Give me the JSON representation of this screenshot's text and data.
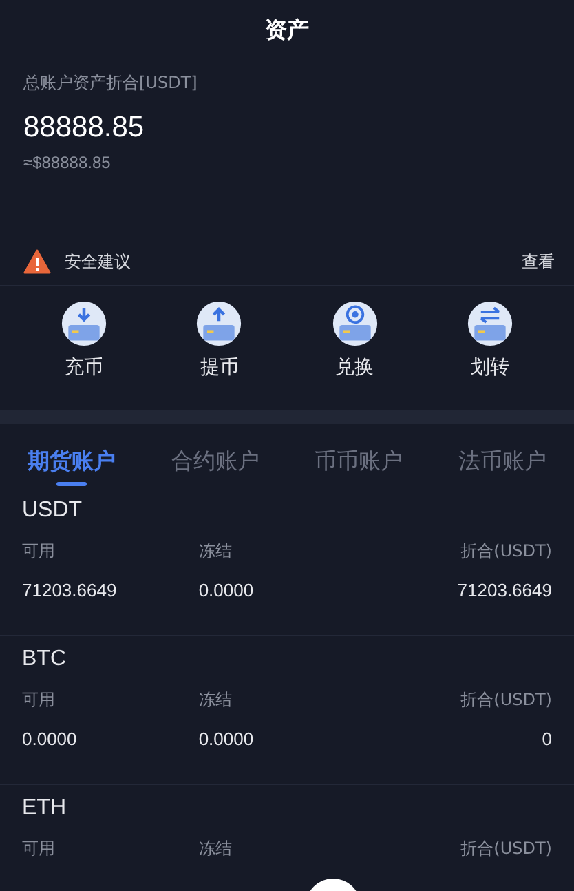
{
  "header": {
    "title": "资产"
  },
  "summary": {
    "label": "总账户资产折合[USDT]",
    "total": "88888.85",
    "approx": "≈$88888.85"
  },
  "security": {
    "label": "安全建议",
    "link": "查看"
  },
  "actions": [
    {
      "label": "充币",
      "kind": "deposit"
    },
    {
      "label": "提币",
      "kind": "withdraw"
    },
    {
      "label": "兑换",
      "kind": "exchange"
    },
    {
      "label": "划转",
      "kind": "transfer"
    }
  ],
  "tabs": [
    {
      "label": "期货账户",
      "selected": true
    },
    {
      "label": "合约账户",
      "selected": false
    },
    {
      "label": "币币账户",
      "selected": false
    },
    {
      "label": "法币账户",
      "selected": false
    }
  ],
  "assets": [
    {
      "name": "USDT",
      "columns": [
        "可用",
        "冻结",
        "折合(USDT)"
      ],
      "values": [
        "71203.6649",
        "0.0000",
        "71203.6649"
      ]
    },
    {
      "name": "BTC",
      "columns": [
        "可用",
        "冻结",
        "折合(USDT)"
      ],
      "values": [
        "0.0000",
        "0.0000",
        "0"
      ]
    },
    {
      "name": "ETH",
      "columns": [
        "可用",
        "冻结",
        "折合(USDT)"
      ]
    }
  ]
}
